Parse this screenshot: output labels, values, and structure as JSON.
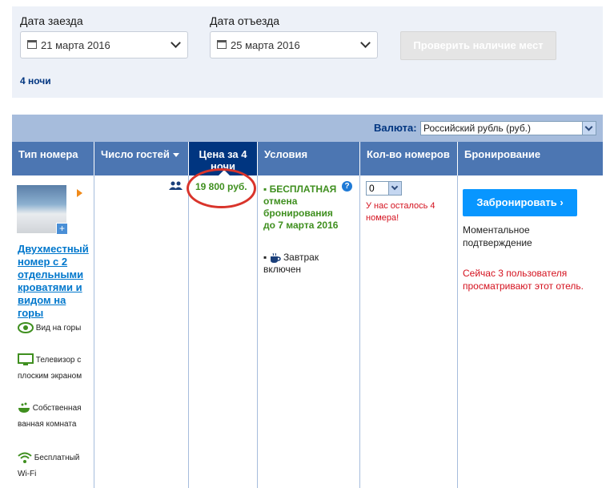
{
  "search": {
    "checkin_label": "Дата заезда",
    "checkin_value": "21 марта 2016",
    "checkout_label": "Дата отъезда",
    "checkout_value": "25 марта 2016",
    "check_button": "Проверить наличие мест",
    "nights": "4 ночи"
  },
  "currency": {
    "label": "Валюта:",
    "value": "Российский рубль (руб.)"
  },
  "table": {
    "headers": {
      "room_type": "Тип номера",
      "guests": "Число гостей",
      "price": "Цена за 4 ночи",
      "conditions": "Условия",
      "rooms_count": "Кол-во номеров",
      "booking": "Бронирование"
    },
    "row": {
      "room_name": "Двухместный номер с 2 отдельными кроватями и видом на горы",
      "amenities": [
        {
          "icon": "eye-icon",
          "label": "Вид на горы"
        },
        {
          "icon": "tv-icon",
          "label": "Телевизор с плоским экраном"
        },
        {
          "icon": "bath-icon",
          "label": "Собственная ванная комната"
        },
        {
          "icon": "wifi-icon",
          "label": "Бесплатный Wi-Fi"
        }
      ],
      "price": "19 800 руб.",
      "free_cancel": "БЕСПЛАТНАЯ отмена бронирования до 7 марта 2016",
      "breakfast": "Завтрак включен",
      "qty_value": "0",
      "rooms_left": "У нас осталось 4 номера!",
      "book_button": "Забронировать",
      "instant": "Моментальное подтверждение",
      "viewers": "Сейчас 3 пользователя просматривают этот отель."
    }
  },
  "colors": {
    "header_bg": "#4c76b2",
    "price_header_bg": "#003580",
    "book_button_bg": "#0896ff",
    "price_text": "#3f8f1f",
    "alert_text": "#d4111e",
    "highlight_circle": "#d9342b"
  }
}
